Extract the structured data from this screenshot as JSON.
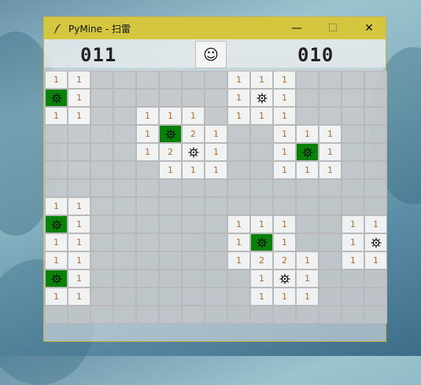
{
  "window": {
    "title": "PyMine - 扫雷",
    "min_glyph": "—",
    "max_glyph": "☐",
    "close_glyph": "✕"
  },
  "header": {
    "mines_left": "011",
    "timer": "010",
    "face": "☺"
  },
  "board": {
    "rows": 14,
    "cols": 15,
    "number_color": "#b36a2a",
    "exploded_color": "#0a820a",
    "cells": [
      [
        "1",
        "1",
        "",
        "",
        "",
        "",
        "",
        "",
        "1",
        "1",
        "1",
        "",
        "",
        "",
        ""
      ],
      [
        "X",
        "1",
        "",
        "",
        "",
        "",
        "",
        "",
        "1",
        "M",
        "1",
        "",
        "",
        "",
        ""
      ],
      [
        "1",
        "1",
        "",
        "",
        "1",
        "1",
        "1",
        "",
        "1",
        "1",
        "1",
        "",
        "",
        "",
        ""
      ],
      [
        "",
        "",
        "",
        "",
        "1",
        "X",
        "2",
        "1",
        "",
        "",
        "1",
        "1",
        "1",
        "",
        ""
      ],
      [
        "",
        "",
        "",
        "",
        "1",
        "2",
        "M",
        "1",
        "",
        "",
        "1",
        "X",
        "1",
        "",
        ""
      ],
      [
        "",
        "",
        "",
        "",
        "",
        "1",
        "1",
        "1",
        "",
        "",
        "1",
        "1",
        "1",
        "",
        ""
      ],
      [
        "",
        "",
        "",
        "",
        "",
        "",
        "",
        "",
        "",
        "",
        "",
        "",
        "",
        "",
        ""
      ],
      [
        "1",
        "1",
        "",
        "",
        "",
        "",
        "",
        "",
        "",
        "",
        "",
        "",
        "",
        "",
        ""
      ],
      [
        "X",
        "1",
        "",
        "",
        "",
        "",
        "",
        "",
        "1",
        "1",
        "1",
        "",
        "",
        "1",
        "1"
      ],
      [
        "1",
        "1",
        "",
        "",
        "",
        "",
        "",
        "",
        "1",
        "X",
        "1",
        "",
        "",
        "1",
        "M"
      ],
      [
        "1",
        "1",
        "",
        "",
        "",
        "",
        "",
        "",
        "1",
        "2",
        "2",
        "1",
        "",
        "1",
        "1"
      ],
      [
        "X",
        "1",
        "",
        "",
        "",
        "",
        "",
        "",
        "",
        "1",
        "M",
        "1",
        "",
        "",
        ""
      ],
      [
        "1",
        "1",
        "",
        "",
        "",
        "",
        "",
        "",
        "",
        "1",
        "1",
        "1",
        "",
        "",
        ""
      ],
      [
        "",
        "",
        "",
        "",
        "",
        "",
        "",
        "",
        "",
        "",
        "",
        "",
        "",
        "",
        ""
      ]
    ]
  }
}
